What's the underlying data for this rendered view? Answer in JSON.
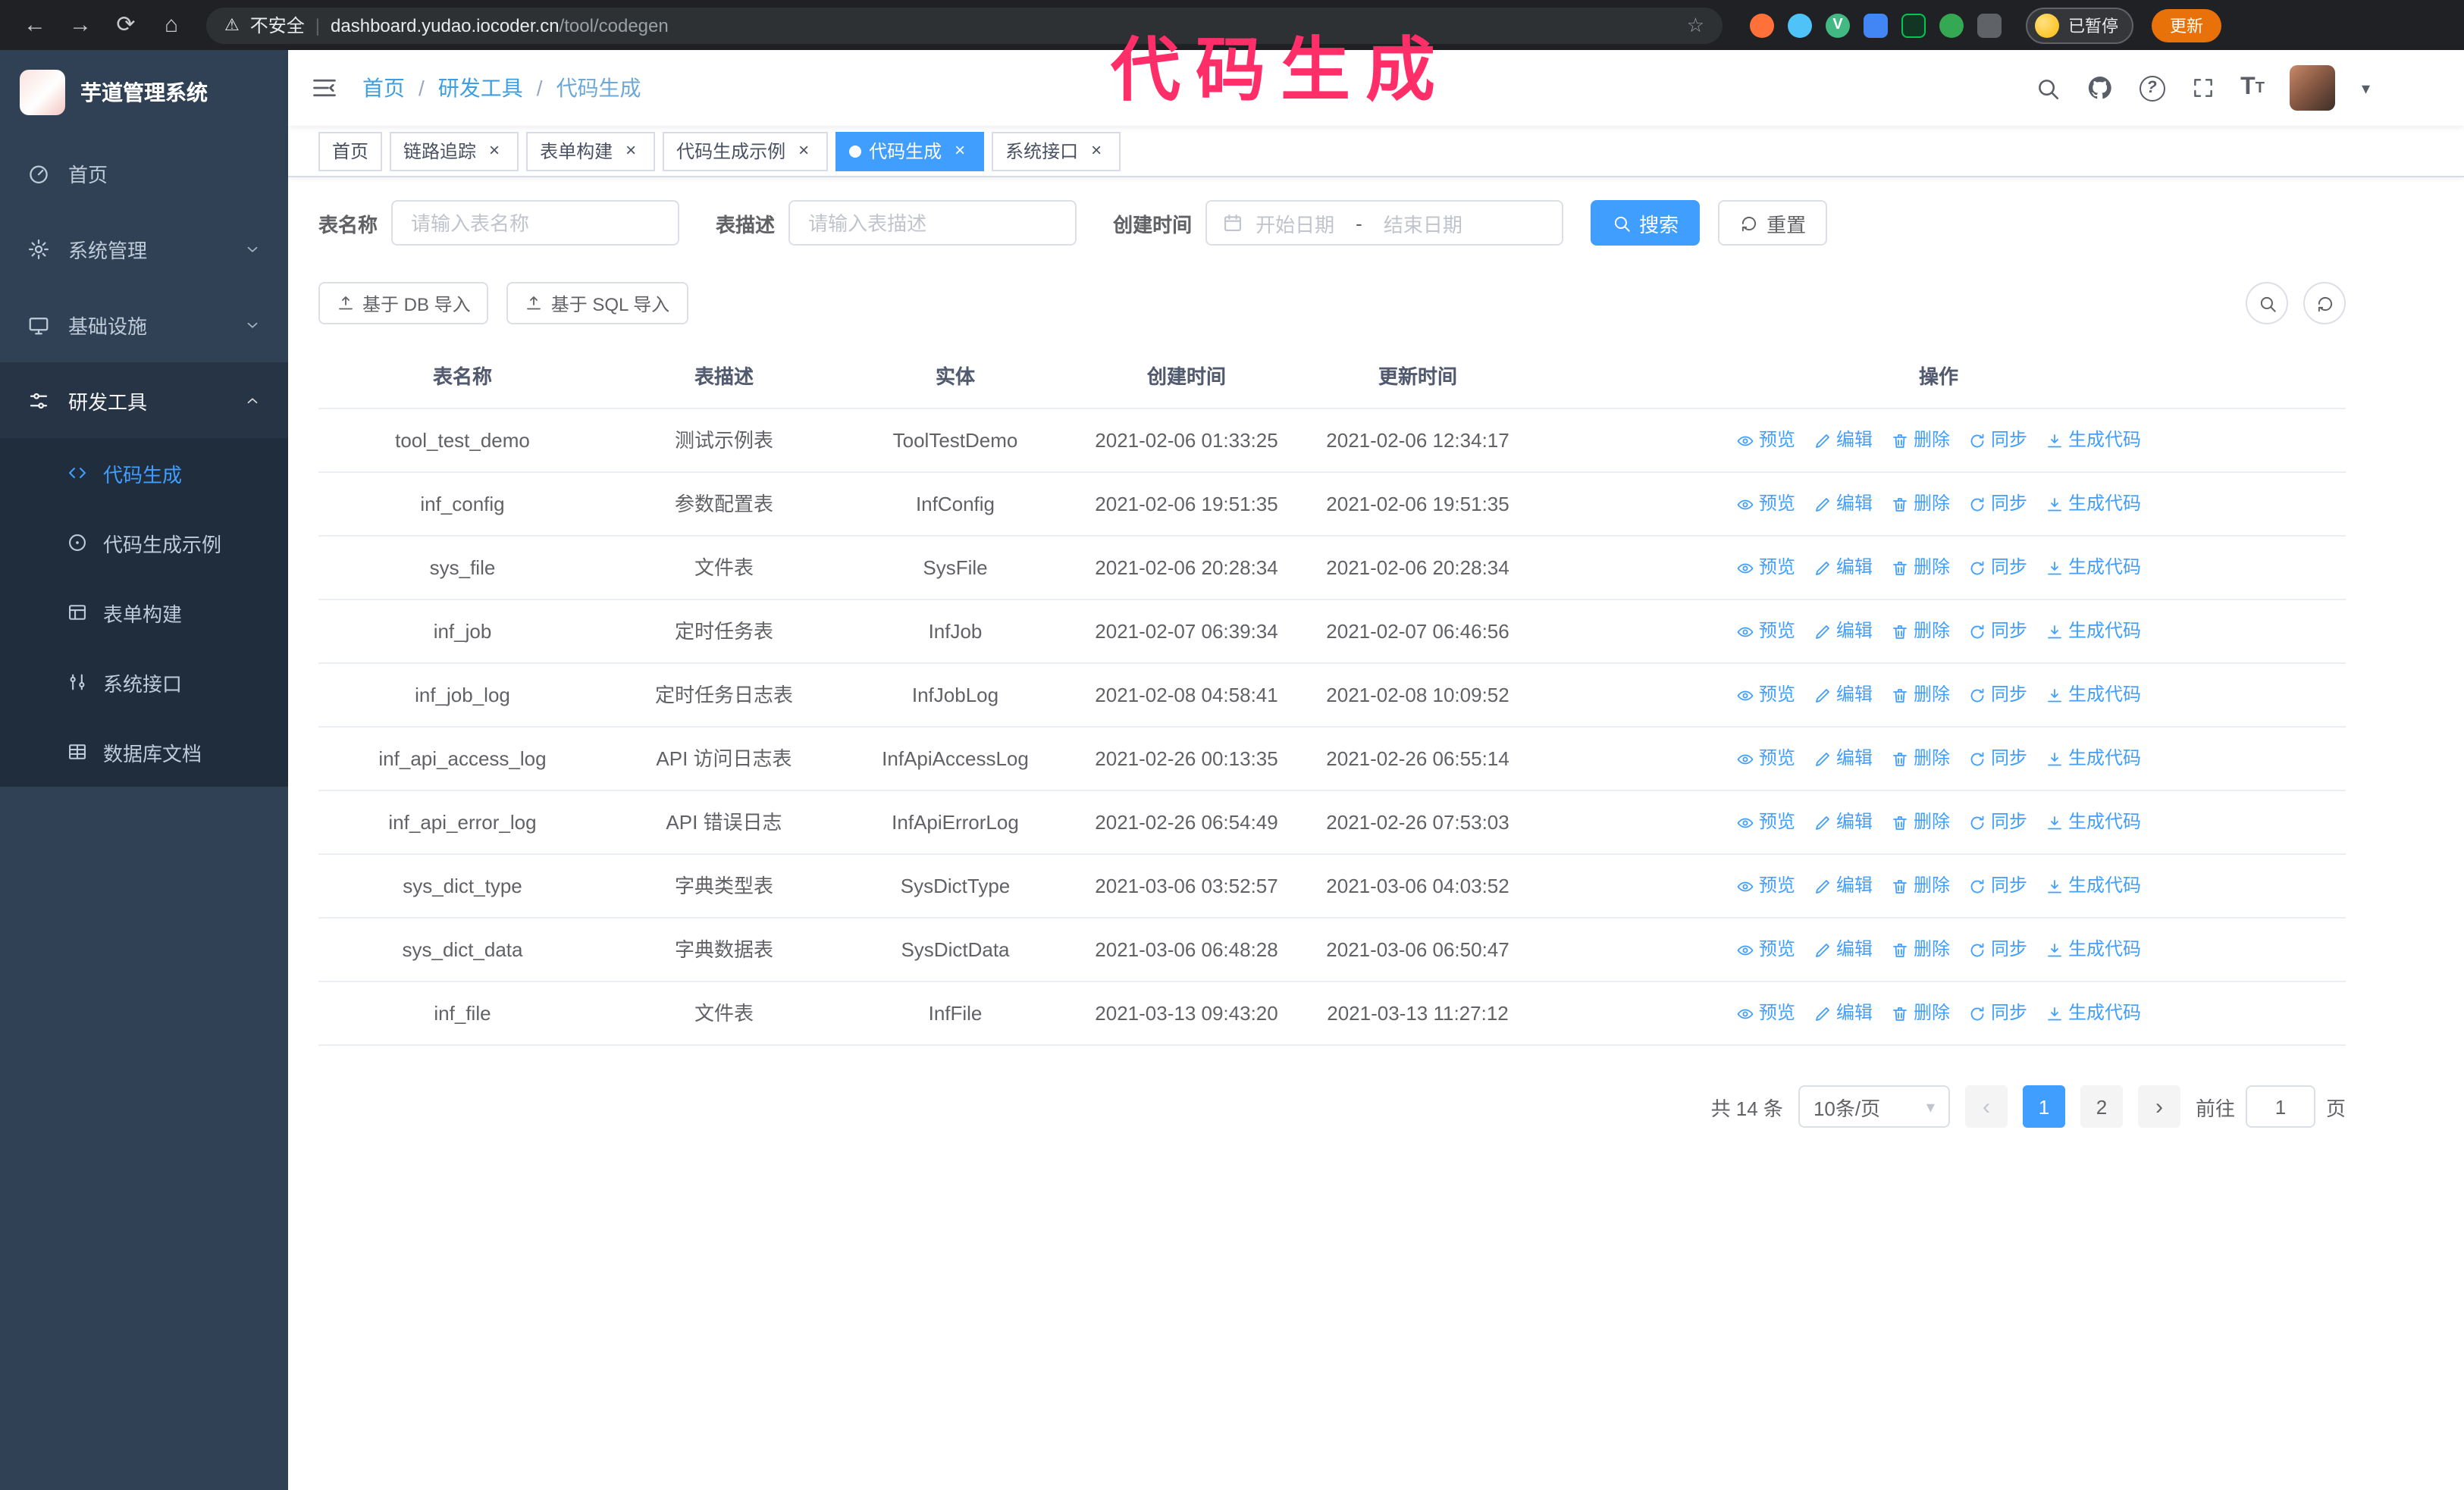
{
  "colors": {
    "primary": "#409eff",
    "sidebar_bg": "#304156",
    "submenu_bg": "#1f2d3d",
    "annotation": "#ff2e68",
    "update_button": "#e8710a"
  },
  "icons": {
    "back": "←",
    "forward": "→",
    "reload": "⟳",
    "home": "⌂",
    "warning": "⚠",
    "star": "☆",
    "close": "×",
    "caret_down": "▾",
    "prev": "‹",
    "next": "›",
    "font_size": "T",
    "question_mark": "?"
  },
  "browser": {
    "security_label": "不安全",
    "separator": "|",
    "url_host": "dashboard.yudao.iocoder.cn",
    "url_path": "/tool/codegen",
    "profile_badge": "已暂停",
    "update_button": "更新"
  },
  "annotation": {
    "text": "代码生成"
  },
  "sidebar": {
    "logo_title": "芋道管理系统",
    "items": [
      {
        "label": "首页"
      },
      {
        "label": "系统管理",
        "chevron": "down"
      },
      {
        "label": "基础设施",
        "chevron": "down"
      },
      {
        "label": "研发工具",
        "chevron": "up",
        "expanded": true
      }
    ],
    "subitems": [
      {
        "label": "代码生成",
        "active": true
      },
      {
        "label": "代码生成示例"
      },
      {
        "label": "表单构建"
      },
      {
        "label": "系统接口"
      },
      {
        "label": "数据库文档"
      }
    ]
  },
  "header": {
    "breadcrumb": [
      "首页",
      "研发工具",
      "代码生成"
    ],
    "breadcrumb_separator": "/"
  },
  "tabs": [
    {
      "label": "首页",
      "closable": false,
      "active": false
    },
    {
      "label": "链路追踪",
      "closable": true,
      "active": false
    },
    {
      "label": "表单构建",
      "closable": true,
      "active": false
    },
    {
      "label": "代码生成示例",
      "closable": true,
      "active": false
    },
    {
      "label": "代码生成",
      "closable": true,
      "active": true
    },
    {
      "label": "系统接口",
      "closable": true,
      "active": false
    }
  ],
  "filters": {
    "table_name_label": "表名称",
    "table_name_placeholder": "请输入表名称",
    "table_desc_label": "表描述",
    "table_desc_placeholder": "请输入表描述",
    "create_time_label": "创建时间",
    "date_start_placeholder": "开始日期",
    "date_separator": "-",
    "date_end_placeholder": "结束日期",
    "search_button": "搜索",
    "reset_button": "重置"
  },
  "toolbar": {
    "import_db": "基于 DB 导入",
    "import_sql": "基于 SQL 导入"
  },
  "table": {
    "columns": [
      "表名称",
      "表描述",
      "实体",
      "创建时间",
      "更新时间",
      "操作"
    ],
    "actions": [
      "预览",
      "编辑",
      "删除",
      "同步",
      "生成代码"
    ],
    "rows": [
      {
        "name": "tool_test_demo",
        "desc": "测试示例表",
        "entity": "ToolTestDemo",
        "created": "2021-02-06 01:33:25",
        "updated": "2021-02-06 12:34:17"
      },
      {
        "name": "inf_config",
        "desc": "参数配置表",
        "entity": "InfConfig",
        "created": "2021-02-06 19:51:35",
        "updated": "2021-02-06 19:51:35"
      },
      {
        "name": "sys_file",
        "desc": "文件表",
        "entity": "SysFile",
        "created": "2021-02-06 20:28:34",
        "updated": "2021-02-06 20:28:34"
      },
      {
        "name": "inf_job",
        "desc": "定时任务表",
        "entity": "InfJob",
        "created": "2021-02-07 06:39:34",
        "updated": "2021-02-07 06:46:56"
      },
      {
        "name": "inf_job_log",
        "desc": "定时任务日志表",
        "entity": "InfJobLog",
        "created": "2021-02-08 04:58:41",
        "updated": "2021-02-08 10:09:52"
      },
      {
        "name": "inf_api_access_log",
        "desc": "API 访问日志表",
        "entity": "InfApiAccessLog",
        "created": "2021-02-26 00:13:35",
        "updated": "2021-02-26 06:55:14"
      },
      {
        "name": "inf_api_error_log",
        "desc": "API 错误日志",
        "entity": "InfApiErrorLog",
        "created": "2021-02-26 06:54:49",
        "updated": "2021-02-26 07:53:03"
      },
      {
        "name": "sys_dict_type",
        "desc": "字典类型表",
        "entity": "SysDictType",
        "created": "2021-03-06 03:52:57",
        "updated": "2021-03-06 04:03:52"
      },
      {
        "name": "sys_dict_data",
        "desc": "字典数据表",
        "entity": "SysDictData",
        "created": "2021-03-06 06:48:28",
        "updated": "2021-03-06 06:50:47"
      },
      {
        "name": "inf_file",
        "desc": "文件表",
        "entity": "InfFile",
        "created": "2021-03-13 09:43:20",
        "updated": "2021-03-13 11:27:12"
      }
    ]
  },
  "pagination": {
    "total": "共 14 条",
    "page_size": "10条/页",
    "pages": [
      "1",
      "2"
    ],
    "active_page": "1",
    "goto_label": "前往",
    "goto_value": "1",
    "goto_suffix": "页"
  }
}
